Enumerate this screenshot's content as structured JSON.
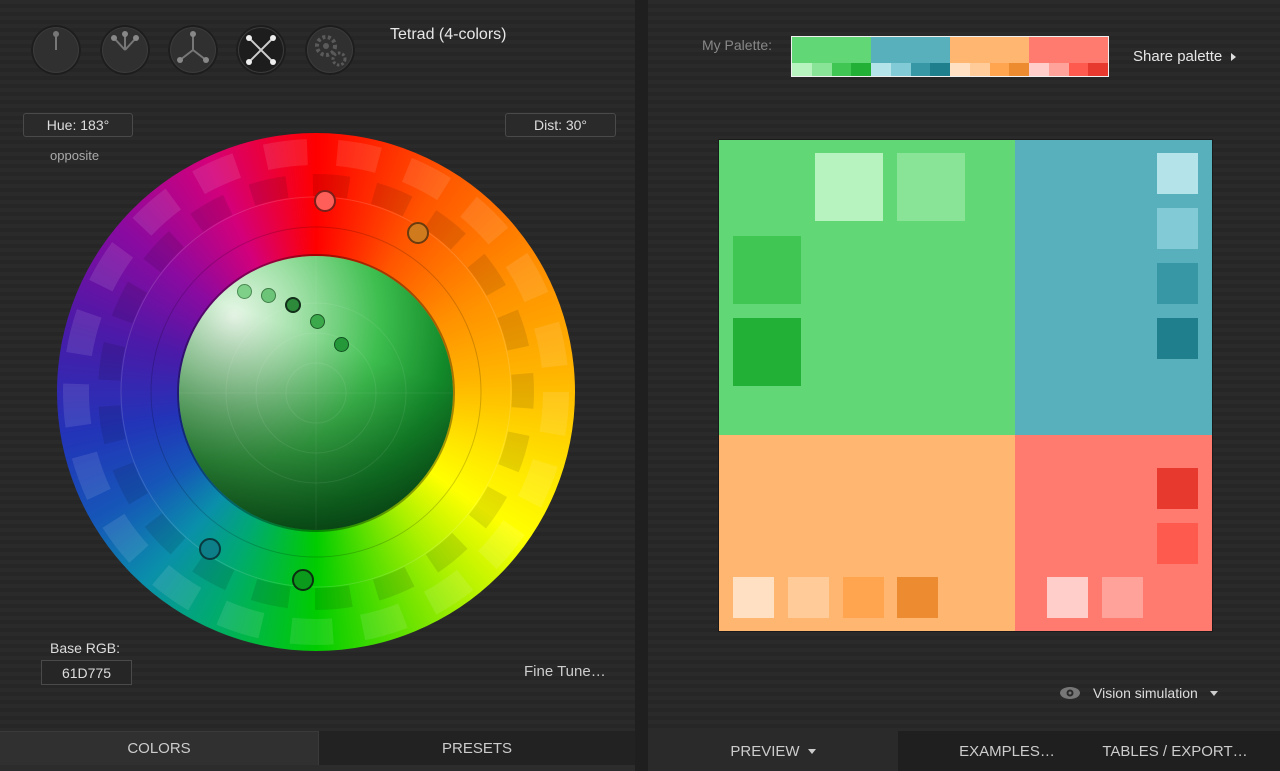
{
  "header": {
    "mode_title": "Tetrad (4-colors)",
    "mode_icons": [
      "mono-icon",
      "adjacent-icon",
      "triad-icon",
      "tetrad-icon",
      "custom-gear-icon"
    ]
  },
  "controls": {
    "hue_label": "Hue: 183°",
    "dist_label": "Dist: 30°",
    "opposite_label": "opposite",
    "base_rgb_label": "Base RGB:",
    "base_rgb_value": "61D775",
    "fine_tune_label": "Fine Tune…"
  },
  "left_tabs": {
    "colors": "COLORS",
    "presets": "PRESETS"
  },
  "palette": {
    "label": "My Palette:",
    "share_label": "Share palette",
    "groups": [
      {
        "main": "#61D775",
        "shades": [
          "#B7F3BF",
          "#89E497",
          "#3FC653",
          "#22B136"
        ]
      },
      {
        "main": "#58B0BC",
        "shades": [
          "#B5E3EA",
          "#82CBD6",
          "#3897A4",
          "#1F7F8C"
        ]
      },
      {
        "main": "#FFB671",
        "shades": [
          "#FFE0C3",
          "#FFCB98",
          "#FFA550",
          "#EC8B2F"
        ]
      },
      {
        "main": "#FF7B6F",
        "shades": [
          "#FFCECB",
          "#FFA29A",
          "#FF5A4E",
          "#E8392F"
        ]
      }
    ]
  },
  "preview_colors": {
    "green": "#61D775",
    "teal": "#58B0BC",
    "orange": "#FFB671",
    "red": "#FF7B6F"
  },
  "vision": {
    "label": "Vision simulation"
  },
  "right_tabs": {
    "preview": "PREVIEW",
    "examples": "EXAMPLES…",
    "tables": "TABLES / EXPORT…"
  }
}
